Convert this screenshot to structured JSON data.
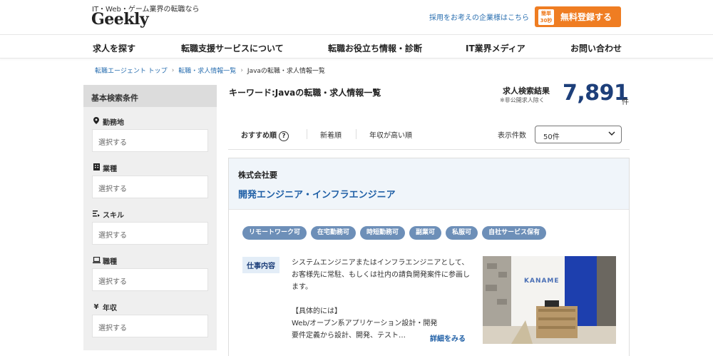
{
  "header": {
    "tagline": "IT・Web・ゲーム業界の転職なら",
    "logo": "Geekly",
    "corp_link": "採用をお考えの企業様はこちら",
    "register_badge_top": "簡単",
    "register_badge_bottom": "30秒",
    "register_label": "無料登録する"
  },
  "nav": {
    "items": [
      {
        "label": "求人を探す"
      },
      {
        "label": "転職支援サービスについて"
      },
      {
        "label": "転職お役立ち情報・診断"
      },
      {
        "label": "IT業界メディア"
      },
      {
        "label": "お問い合わせ"
      }
    ]
  },
  "breadcrumb": {
    "items": [
      "転職エージェント トップ",
      "転職・求人情報一覧",
      "Javaの転職・求人情報一覧"
    ]
  },
  "sidebar": {
    "title": "基本検索条件",
    "filters": [
      {
        "label": "勤務地",
        "icon": "map-pin-icon",
        "placeholder": "選択する"
      },
      {
        "label": "業種",
        "icon": "building-icon",
        "placeholder": "選択する"
      },
      {
        "label": "スキル",
        "icon": "list-icon",
        "placeholder": "選択する"
      },
      {
        "label": "職種",
        "icon": "laptop-icon",
        "placeholder": "選択する"
      },
      {
        "label": "年収",
        "icon": "yen-icon",
        "placeholder": "選択する"
      }
    ]
  },
  "results": {
    "keyword_title": "キーワード:Javaの転職・求人情報一覧",
    "label": "求人検索結果",
    "note": "※非公開求人除く",
    "count": "7,891",
    "unit": "件"
  },
  "sort": {
    "recommended": "おすすめ順",
    "help": "?",
    "newest": "新着順",
    "salary": "年収が高い順",
    "per_page_label": "表示件数",
    "per_page_value": "50件"
  },
  "job": {
    "company": "株式会社要",
    "title": "開発エンジニア・インフラエンジニア",
    "tags": [
      "リモートワーク可",
      "在宅勤務可",
      "時短勤務可",
      "副業可",
      "私服可",
      "自社サービス保有"
    ],
    "duty_label": "仕事内容",
    "description": "システムエンジニアまたはインフラエンジニアとして、お客様先に常駐、もしくは社内の請負開発案件に参画します。\n\n【具体的には】\nWeb/オープン系アプリケーション設計・開発\n要件定義から設計、開発、テスト…",
    "more": "詳細をみる",
    "photo_sign": "KANAME"
  },
  "colors": {
    "accent_orange": "#ef7d22",
    "brand_navy": "#1d3f7a",
    "link_blue": "#1f5fa6",
    "tag_blue": "#6d8fb8"
  }
}
